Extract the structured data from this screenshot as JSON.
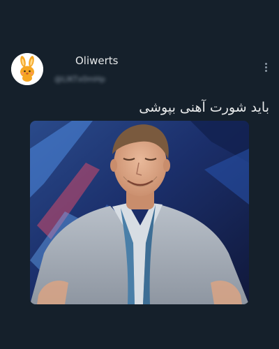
{
  "post": {
    "author": {
      "display_name": "Oliwerts",
      "handle": "@LIKTx0mHp",
      "avatar_icon": "orange-bunny-icon"
    },
    "text": "باید شورت آهنی بپوشی",
    "more_icon": "vertical-ellipsis-icon",
    "media": {
      "description_icon": "photo-man-in-grey-suit-laughing"
    }
  },
  "colors": {
    "background": "#15202b",
    "text": "#e7e9ea",
    "muted": "#8b98a5",
    "avatar_accent": "#f5a623"
  }
}
